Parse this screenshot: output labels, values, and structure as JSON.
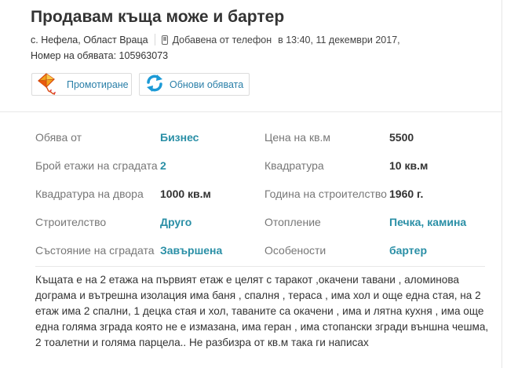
{
  "listing": {
    "title": "Продавам къща може и бартер",
    "location": "с. Нефела, Област Враца",
    "added_from": "Добавена от телефон",
    "added_time": "в 13:40, 11 декември 2017,",
    "ad_number": "Номер на обявата: 105963073"
  },
  "actions": {
    "promote_label": "Промотиране",
    "refresh_label": "Обнови обявата"
  },
  "details": [
    {
      "label": "Обява от",
      "value": "Бизнес",
      "label2": "Цена на кв.м",
      "value2": "5500"
    },
    {
      "label": "Брой етажи на сградата",
      "value": "2",
      "label2": "Квадратура",
      "value2": "10 кв.м"
    },
    {
      "label": "Квадратура на двора",
      "value": "1000 кв.м",
      "label2": "Година на строителство",
      "value2": "1960 г."
    },
    {
      "label": "Строителство",
      "value": "Друго",
      "label2": "Отопление",
      "value2": "Печка, камина"
    },
    {
      "label": "Състояние на сградата",
      "value": "Завършена",
      "label2": "Особености",
      "value2": "бартер"
    }
  ],
  "description": "Къщата е на 2 етажа на първият етаж е целят с таракот ,окачени тавани , аломинова дограма и вътрешна изолация има баня , спалня , тераса , има хол и още една стая, на 2 етаж има 2 спални, 1 децка стая и хол, таваните са окачени , има и лятна кухня , има още една голяма зграда която не е измазана, има геран , има стопански згради външна чешма, 2 тоалетни и голяма парцела.. Не разбизра от кв.м така ги написах",
  "colors": {
    "link": "#2a8fa6",
    "button_text": "#2a7fa8",
    "label": "#777777",
    "text": "#333333"
  },
  "icons": {
    "phone": "phone-icon",
    "promote": "kite-icon",
    "refresh": "refresh-icon"
  }
}
